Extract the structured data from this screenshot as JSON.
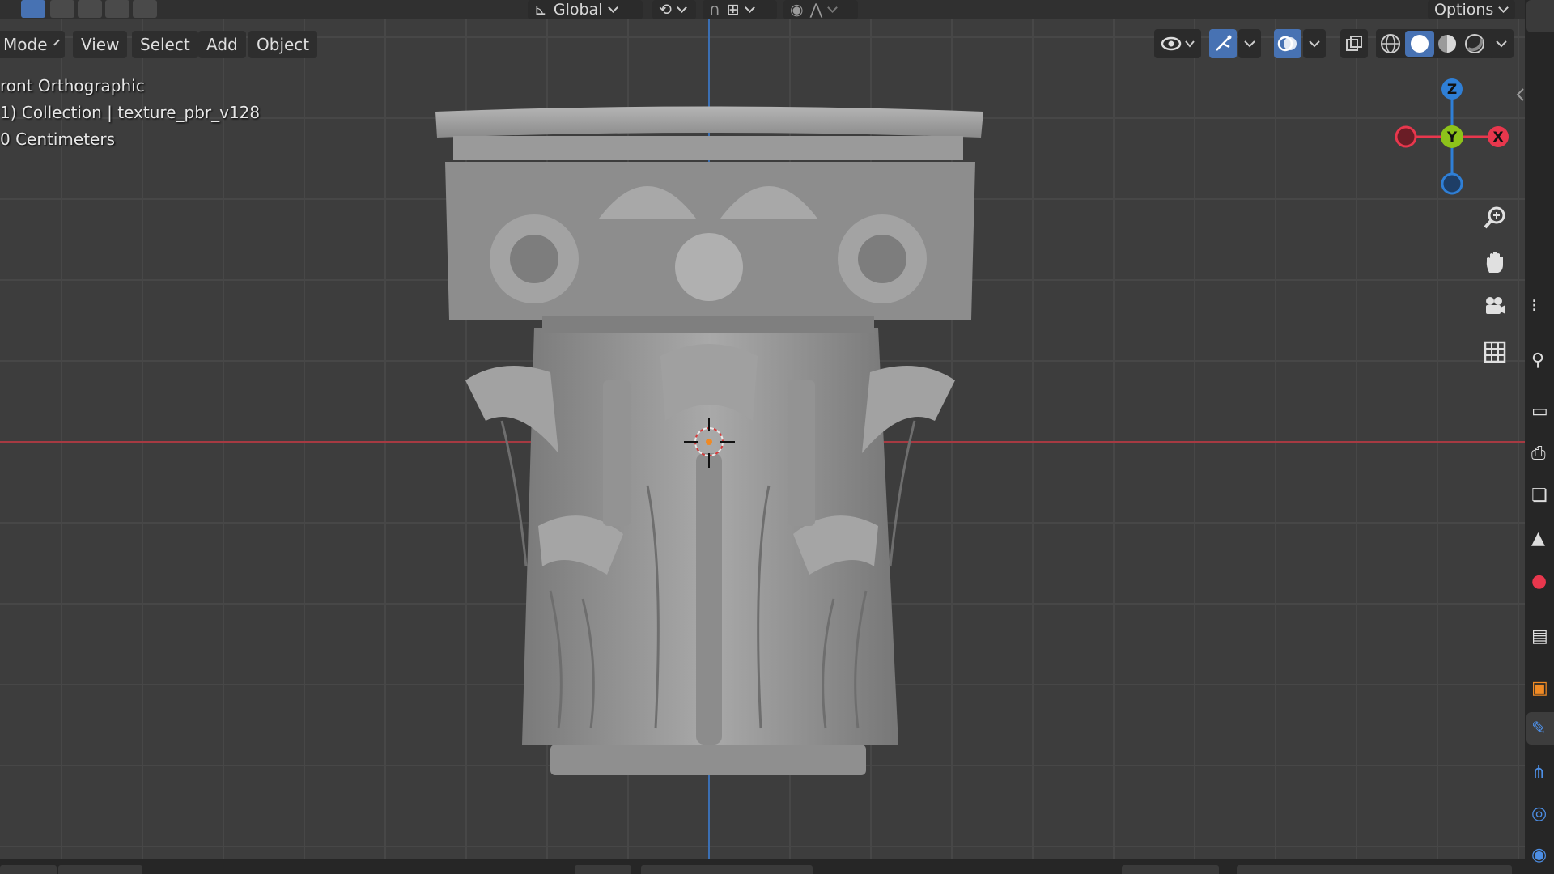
{
  "header": {
    "transform_orientation": "Global",
    "options_label": "Options"
  },
  "menu": {
    "mode_label": "Mode",
    "view_label": "View",
    "select_label": "Select",
    "add_label": "Add",
    "object_label": "Object"
  },
  "overlay": {
    "view_name": "ront Orthographic",
    "collection_info": "1) Collection | texture_pbr_v128",
    "scale_info": "0 Centimeters"
  },
  "gizmo": {
    "z_label": "Z",
    "y_label": "Y",
    "x_label": "X"
  },
  "icons": {
    "zoom": "zoom-in-icon",
    "pan": "hand-icon",
    "camera": "camera-icon",
    "ortho": "grid-icon"
  },
  "colors": {
    "accent": "#4772b3",
    "axis_x": "#e8374d",
    "axis_y": "#8dc31a",
    "axis_z": "#2f7fd6",
    "x_axis_line": "#a63a42",
    "z_axis_line": "#3b6fb3",
    "grid": "#4a4a4a",
    "background": "#3d3d3d"
  }
}
